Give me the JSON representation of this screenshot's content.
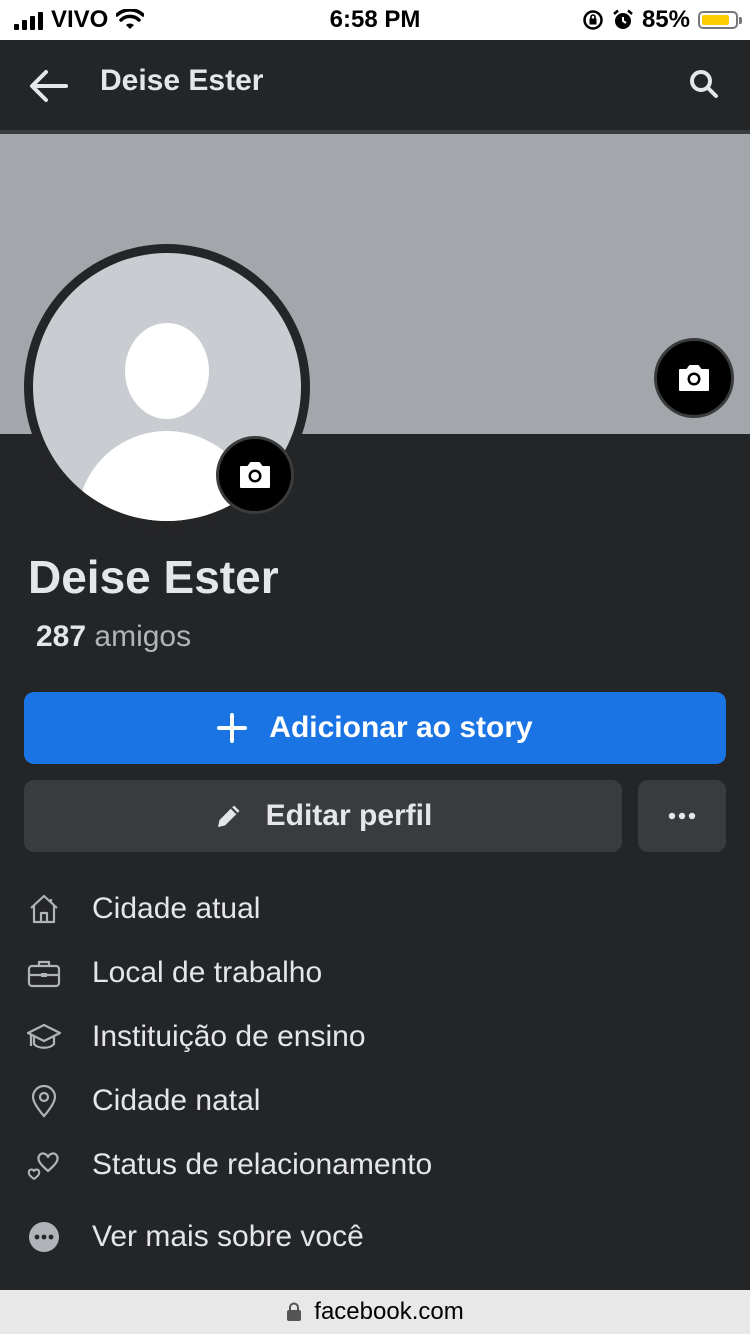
{
  "status_bar": {
    "carrier": "VIVO",
    "time": "6:58 PM",
    "battery": "85%",
    "battery_level": 0.85
  },
  "header": {
    "title": "Deise Ester"
  },
  "profile": {
    "name": "Deise Ester",
    "friends_count": "287",
    "friends_label": "amigos"
  },
  "actions": {
    "story_label": "Adicionar ao story",
    "edit_label": "Editar perfil"
  },
  "details": [
    {
      "icon": "home-icon",
      "label": "Cidade atual"
    },
    {
      "icon": "briefcase-icon",
      "label": "Local de trabalho"
    },
    {
      "icon": "graduation-cap-icon",
      "label": "Instituição de ensino"
    },
    {
      "icon": "location-pin-icon",
      "label": "Cidade natal"
    },
    {
      "icon": "hearts-icon",
      "label": "Status de relacionamento"
    },
    {
      "icon": "more-circle-icon",
      "label": "Ver mais sobre você"
    }
  ],
  "browser": {
    "url": "facebook.com"
  },
  "colors": {
    "accent": "#1b74e4",
    "background": "#242526",
    "button": "#3a3b3c",
    "cover": "#a3a6ab"
  }
}
